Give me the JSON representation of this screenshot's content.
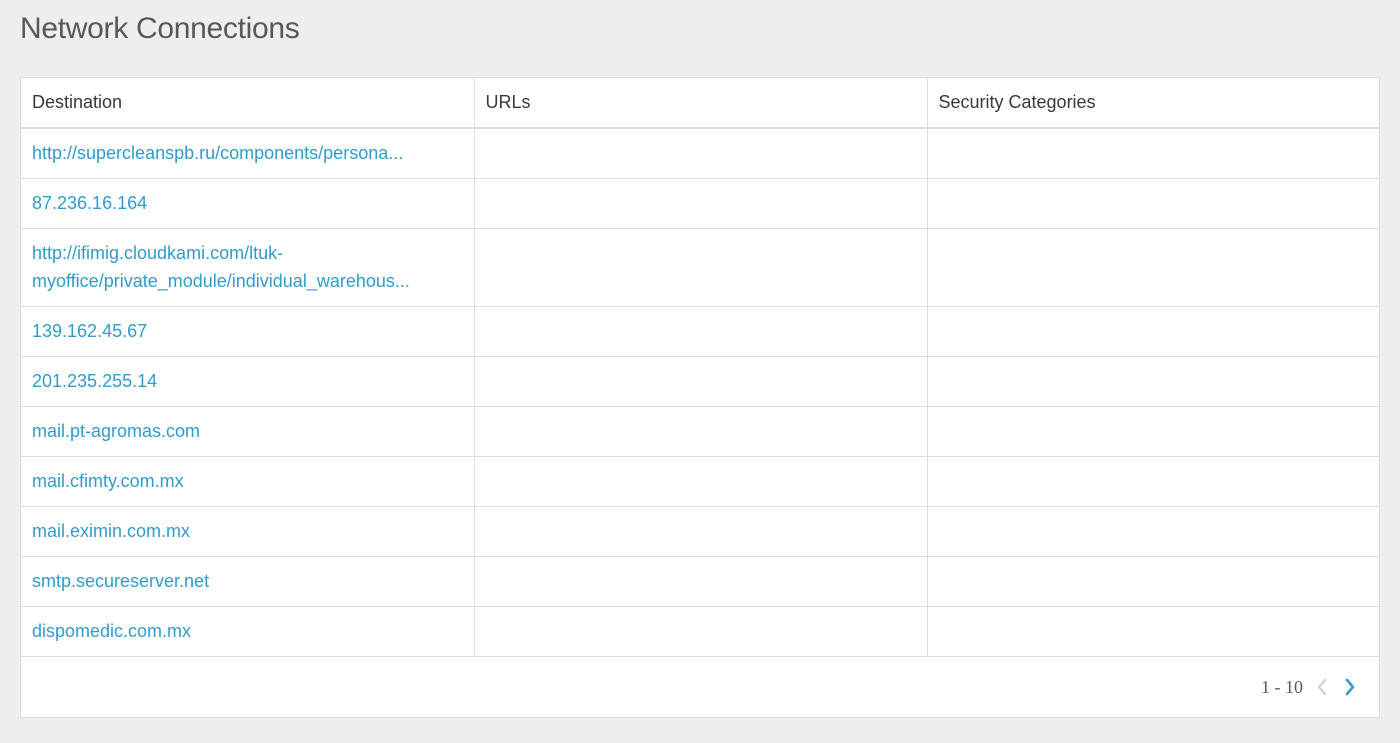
{
  "page": {
    "title": "Network Connections"
  },
  "table": {
    "columns": [
      "Destination",
      "URLs",
      "Security Categories"
    ],
    "rows": [
      {
        "destination": "http://supercleanspb.ru/components/persona...",
        "urls": "",
        "categories": ""
      },
      {
        "destination": "87.236.16.164",
        "urls": "",
        "categories": ""
      },
      {
        "destination": "http://ifimig.cloudkami.com/ltuk-myoffice/private_module/individual_warehous...",
        "urls": "",
        "categories": ""
      },
      {
        "destination": "139.162.45.67",
        "urls": "",
        "categories": ""
      },
      {
        "destination": "201.235.255.14",
        "urls": "",
        "categories": ""
      },
      {
        "destination": "mail.pt-agromas.com",
        "urls": "",
        "categories": ""
      },
      {
        "destination": "mail.cfimty.com.mx",
        "urls": "",
        "categories": ""
      },
      {
        "destination": "mail.eximin.com.mx",
        "urls": "",
        "categories": ""
      },
      {
        "destination": "smtp.secureserver.net",
        "urls": "",
        "categories": ""
      },
      {
        "destination": "dispomedic.com.mx",
        "urls": "",
        "categories": ""
      }
    ]
  },
  "pagination": {
    "range": "1 - 10",
    "prev_icon": "chevron-left-icon",
    "next_icon": "chevron-right-icon"
  },
  "colors": {
    "link": "#2f9ccd",
    "disabled": "#cfcfcf",
    "background": "#eeeeee"
  }
}
